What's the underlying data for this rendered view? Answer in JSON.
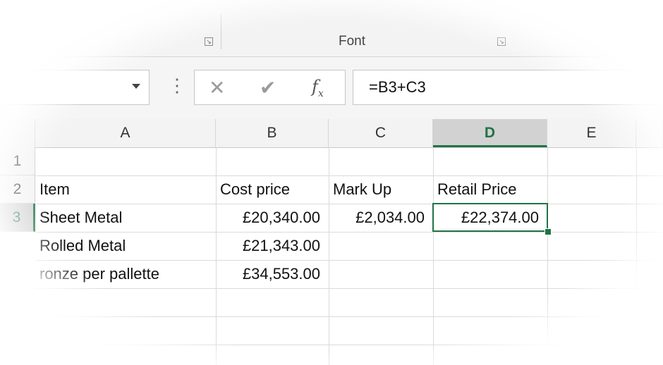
{
  "ribbon": {
    "groups": [
      {
        "label": "Font"
      }
    ]
  },
  "formula_bar": {
    "name_box_value": "",
    "formula": "=B3+C3",
    "cancel_icon": "x-icon",
    "enter_icon": "check-icon",
    "fx_label": "fx"
  },
  "grid": {
    "columns": [
      "A",
      "B",
      "C",
      "D",
      "E"
    ],
    "active_column": "D",
    "rows": [
      "1",
      "2",
      "3"
    ],
    "active_row": "3",
    "cells": {
      "A2": "Item",
      "B2": "Cost price",
      "C2": "Mark Up",
      "D2": "Retail Price",
      "A3": "Sheet Metal",
      "B3": "£20,340.00",
      "C3": "£2,034.00",
      "D3": "£22,374.00",
      "A4": "Rolled Metal",
      "B4": "£21,343.00",
      "A5": "ronze per pallette",
      "B5": "£34,553.00"
    }
  },
  "colors": {
    "accent": "#217346"
  }
}
